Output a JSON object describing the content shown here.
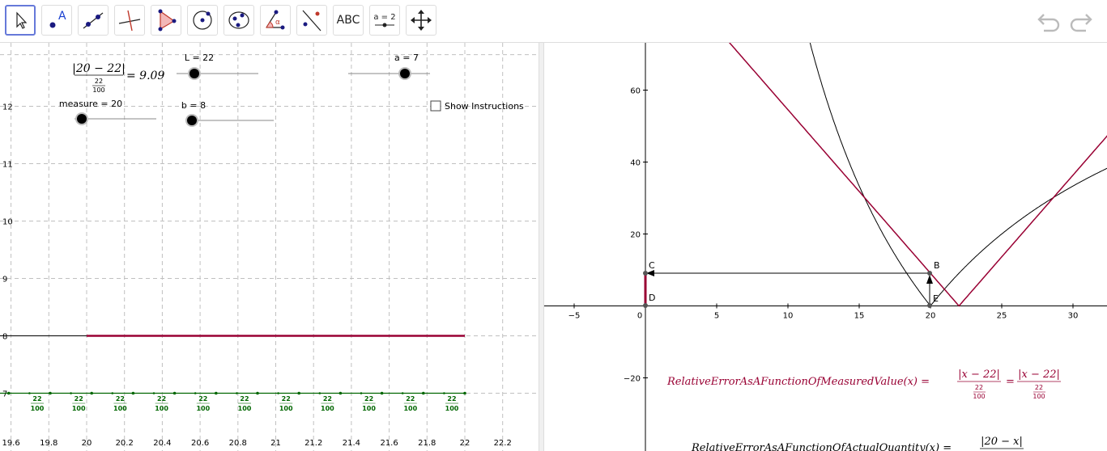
{
  "toolbar": {
    "tools": [
      {
        "name": "move-tool",
        "icon": "arrow-pointer-icon",
        "selected": true
      },
      {
        "name": "point-tool",
        "icon": "point-label-icon",
        "label": "A"
      },
      {
        "name": "line-tool",
        "icon": "line-through-points-icon"
      },
      {
        "name": "perpendicular-tool",
        "icon": "perpendicular-line-icon"
      },
      {
        "name": "polygon-tool",
        "icon": "triangle-icon"
      },
      {
        "name": "circle-tool",
        "icon": "circle-center-point-icon"
      },
      {
        "name": "ellipse-tool",
        "icon": "ellipse-icon"
      },
      {
        "name": "angle-tool",
        "icon": "angle-icon",
        "label": "α"
      },
      {
        "name": "reflect-tool",
        "icon": "reflect-about-line-icon"
      },
      {
        "name": "text-tool",
        "icon": "text-icon",
        "label": "ABC"
      },
      {
        "name": "slider-tool",
        "icon": "slider-icon",
        "label": "a = 2"
      },
      {
        "name": "move-view-tool",
        "icon": "move-arrows-icon"
      }
    ],
    "undo": {
      "icon": "undo-icon"
    },
    "redo": {
      "icon": "redo-icon"
    }
  },
  "left_graphics": {
    "formula": {
      "numerator": "|20 − 22|",
      "denominator_num": "22",
      "denominator_den": "100",
      "result": "= 9.09"
    },
    "sliders": {
      "L": {
        "label": "L = 22"
      },
      "a": {
        "label": "a = 7"
      },
      "measure": {
        "label": "measure = 20"
      },
      "b": {
        "label": "b = 8"
      }
    },
    "show_instructions": {
      "label": "Show Instructions",
      "checked": false
    },
    "x_ticks": [
      "19.6",
      "19.8",
      "20",
      "20.2",
      "20.4",
      "20.6",
      "20.8",
      "21",
      "21.2",
      "21.4",
      "21.6",
      "21.8",
      "22",
      "22.2"
    ],
    "y_ticks": [
      "12",
      "11",
      "10",
      "9",
      "8",
      "7"
    ],
    "fraction_labels": [
      {
        "num": "22",
        "den": "100"
      },
      {
        "num": "22",
        "den": "100"
      },
      {
        "num": "22",
        "den": "100"
      },
      {
        "num": "22",
        "den": "100"
      },
      {
        "num": "22",
        "den": "100"
      },
      {
        "num": "22",
        "den": "100"
      },
      {
        "num": "22",
        "den": "100"
      },
      {
        "num": "22",
        "den": "100"
      },
      {
        "num": "22",
        "den": "100"
      },
      {
        "num": "22",
        "den": "100"
      },
      {
        "num": "22",
        "den": "100"
      }
    ],
    "colors": {
      "crimson": "#990033",
      "green": "#006600",
      "grid": "#c0c0c0"
    }
  },
  "right_graphics": {
    "x_ticks": [
      "−5",
      "0",
      "5",
      "10",
      "15",
      "20",
      "25",
      "30"
    ],
    "y_ticks": [
      "60",
      "40",
      "20",
      "−20"
    ],
    "points": {
      "B": "B",
      "C": "C",
      "D": "D",
      "E": "E"
    },
    "function1": {
      "name": "RelativeErrorAsAFunctionOfMeasuredValue(x) =",
      "num": "|x − 22|",
      "den_num": "22",
      "den_den": "100",
      "eq": "="
    },
    "function2": {
      "name": "RelativeErrorAsAFunctionOfActualQuantity(x) =",
      "num": "|20 − x|"
    },
    "colors": {
      "crimson": "#990033",
      "black": "#000000"
    }
  }
}
